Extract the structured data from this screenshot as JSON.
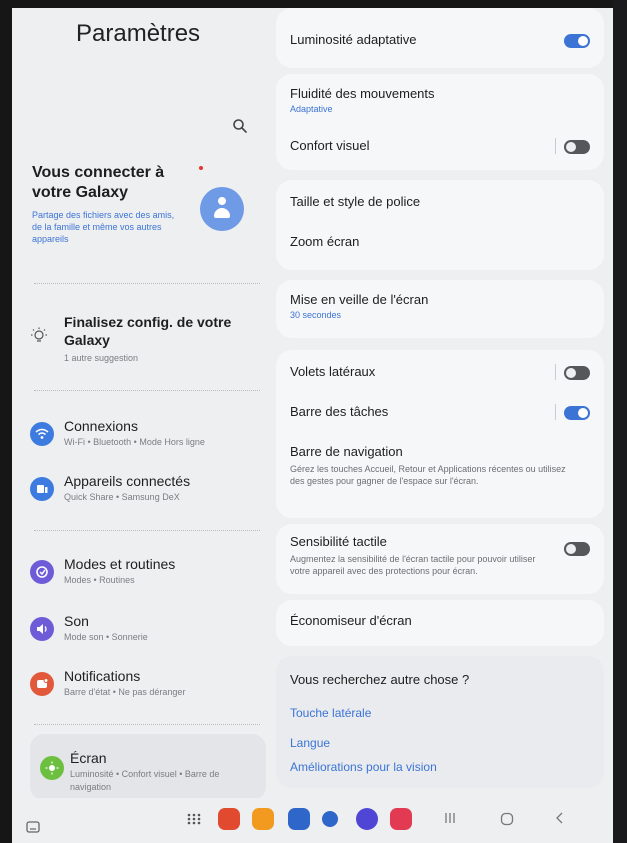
{
  "colors": {
    "accent": "#3c74d6",
    "bg": "#eeeff1",
    "card": "#f6f7f8"
  },
  "left": {
    "title": "Paramètres",
    "search_icon": "search-icon",
    "account": {
      "title": "Vous connecter à votre Galaxy",
      "subtitle": "Partage des fichiers avec des amis, de la famille et même vos autres appareils"
    },
    "suggestion": {
      "title": "Finalisez config. de votre Galaxy",
      "subtitle": "1 autre suggestion"
    },
    "menu": [
      {
        "title": "Connexions",
        "subtitle": "Wi-Fi • Bluetooth • Mode Hors ligne",
        "icon": "wifi-icon",
        "color": "#3d7be0"
      },
      {
        "title": "Appareils connectés",
        "subtitle": "Quick Share • Samsung DeX",
        "icon": "devices-icon",
        "color": "#3d7be0"
      },
      {
        "title": "Modes et routines",
        "subtitle": "Modes • Routines",
        "icon": "modes-icon",
        "color": "#6d5bd8"
      },
      {
        "title": "Son",
        "subtitle": "Mode son • Sonnerie",
        "icon": "volume-icon",
        "color": "#6d5bd8"
      },
      {
        "title": "Notifications",
        "subtitle": "Barre d'état • Ne pas déranger",
        "icon": "notification-icon",
        "color": "#e2583b"
      },
      {
        "title": "Écran",
        "subtitle": "Luminosité • Confort visuel • Barre de navigation",
        "icon": "brightness-icon",
        "color": "#6cbf3f"
      }
    ]
  },
  "right": {
    "adaptive_brightness": {
      "title": "Luminosité adaptative",
      "on": true
    },
    "motion_smoothness": {
      "title": "Fluidité des mouvements",
      "value": "Adaptative"
    },
    "eye_comfort": {
      "title": "Confort visuel",
      "on": false
    },
    "font": {
      "title": "Taille et style de police"
    },
    "zoom": {
      "title": "Zoom écran"
    },
    "timeout": {
      "title": "Mise en veille de l'écran",
      "value": "30 secondes"
    },
    "edge_panels": {
      "title": "Volets latéraux",
      "on": false
    },
    "taskbar": {
      "title": "Barre des tâches",
      "on": true
    },
    "navbar": {
      "title": "Barre de navigation",
      "desc": "Gérez les touches Accueil, Retour et Applications récentes ou utilisez des gestes pour gagner de l'espace sur l'écran."
    },
    "touch": {
      "title": "Sensibilité tactile",
      "desc": "Augmentez la sensibilité de l'écran tactile pour pouvoir utiliser votre appareil avec des protections pour écran.",
      "on": false
    },
    "screensaver": {
      "title": "Économiseur d'écran"
    },
    "more": {
      "title": "Vous recherchez autre chose ?",
      "links": [
        "Touche latérale",
        "Langue",
        "Améliorations pour la vision"
      ]
    }
  },
  "nav": {
    "apps": [
      {
        "icon": "apps-grid-icon",
        "color": ""
      },
      {
        "icon": "notes-app-icon",
        "color": "#e24a2f"
      },
      {
        "icon": "folder-app-icon",
        "color": "#f29a1f"
      },
      {
        "icon": "calendar-app-icon",
        "color": "#2e66c9"
      },
      {
        "icon": "messages-app-icon",
        "color": "#2e66c9"
      },
      {
        "icon": "internet-app-icon",
        "color": "#4f46d6"
      },
      {
        "icon": "camera-app-icon",
        "color": "#e23a52"
      }
    ],
    "keys": [
      "recent-apps-icon",
      "home-icon",
      "back-icon"
    ]
  }
}
